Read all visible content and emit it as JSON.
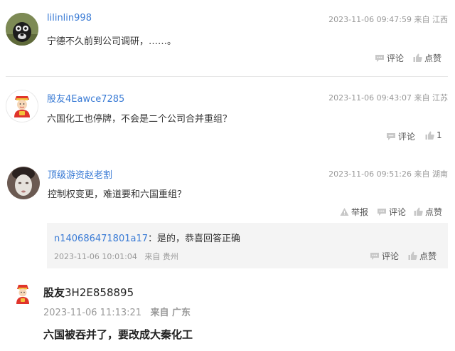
{
  "comments": [
    {
      "username": "lilinlin998",
      "time": "2023-11-06 09:47:59",
      "location": "来自 江西",
      "content": "宁德不久前到公司调研，……。",
      "actions": {
        "comment": "评论",
        "like": "点赞"
      }
    },
    {
      "username": "股友4Eawce7285",
      "time": "2023-11-06 09:43:07",
      "location": "来自 江苏",
      "content": "六国化工也停牌，不会是二个公司合并重组？",
      "actions": {
        "comment": "评论",
        "like": "1"
      }
    },
    {
      "username": "顶级游资赵老割",
      "time": "2023-11-06 09:51:26",
      "location": "来自 湖南",
      "content": "控制权变更，难道要和六国重组？",
      "actions": {
        "report": "举报",
        "comment": "评论",
        "like": "点赞"
      },
      "reply": {
        "username": "n140686471801a17",
        "separator": "：",
        "text": "是的，恭喜回答正确",
        "time": "2023-11-06 10:01:04",
        "location": "来自 贵州",
        "actions": {
          "comment": "评论",
          "like": "点赞"
        }
      }
    },
    {
      "username_prefix": "股友",
      "username_suffix": "3H2E858895",
      "time": "2023-11-06 11:13:21",
      "location": "来自 广东",
      "content": "六国被吞并了，要改成大秦化工"
    }
  ],
  "colors": {
    "link": "#3a7bd5",
    "meta": "#999999",
    "divider": "#e6e6e6",
    "reply_bg": "#f4f4f4"
  },
  "icons": [
    "comment-icon",
    "like-icon",
    "report-icon",
    "avatar-dog",
    "avatar-caishen",
    "avatar-face"
  ]
}
